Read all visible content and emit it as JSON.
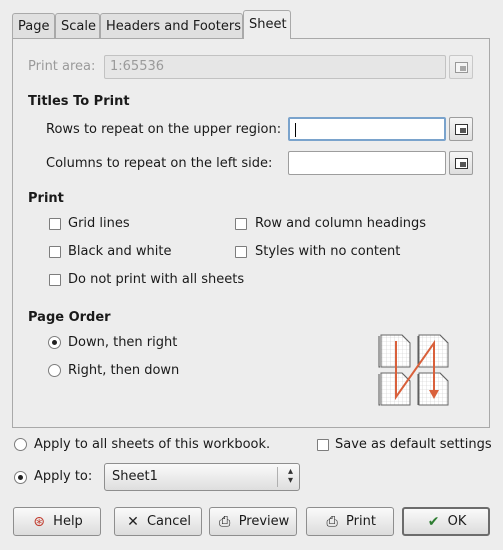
{
  "tabs": [
    {
      "label": "Page"
    },
    {
      "label": "Scale"
    },
    {
      "label": "Headers and Footers"
    },
    {
      "label": "Sheet"
    }
  ],
  "print_area": {
    "label": "Print area:",
    "value": "1:65536"
  },
  "titles_to_print": {
    "heading": "Titles To Print",
    "rows_label": "Rows to repeat on the upper region:",
    "rows_value": "",
    "columns_label": "Columns to repeat on the left side:",
    "columns_value": ""
  },
  "print": {
    "heading": "Print",
    "grid_lines": "Grid lines",
    "row_col_headings": "Row and column headings",
    "black_white": "Black and white",
    "styles_no_content": "Styles with no content",
    "do_not_print_all": "Do not print with all sheets"
  },
  "page_order": {
    "heading": "Page Order",
    "down_then_right": "Down, then right",
    "right_then_down": "Right, then down",
    "selected": "down_then_right",
    "order_icon": "page-order-down-right-icon",
    "arrow_color": "#d9603b"
  },
  "apply": {
    "all_sheets": "Apply to all sheets of this workbook.",
    "save_default": "Save as default settings",
    "apply_to": "Apply to:",
    "sheet": "Sheet1",
    "selected": "apply_to"
  },
  "buttons": {
    "help": "Help",
    "cancel": "Cancel",
    "preview": "Preview",
    "print": "Print",
    "ok": "OK"
  }
}
